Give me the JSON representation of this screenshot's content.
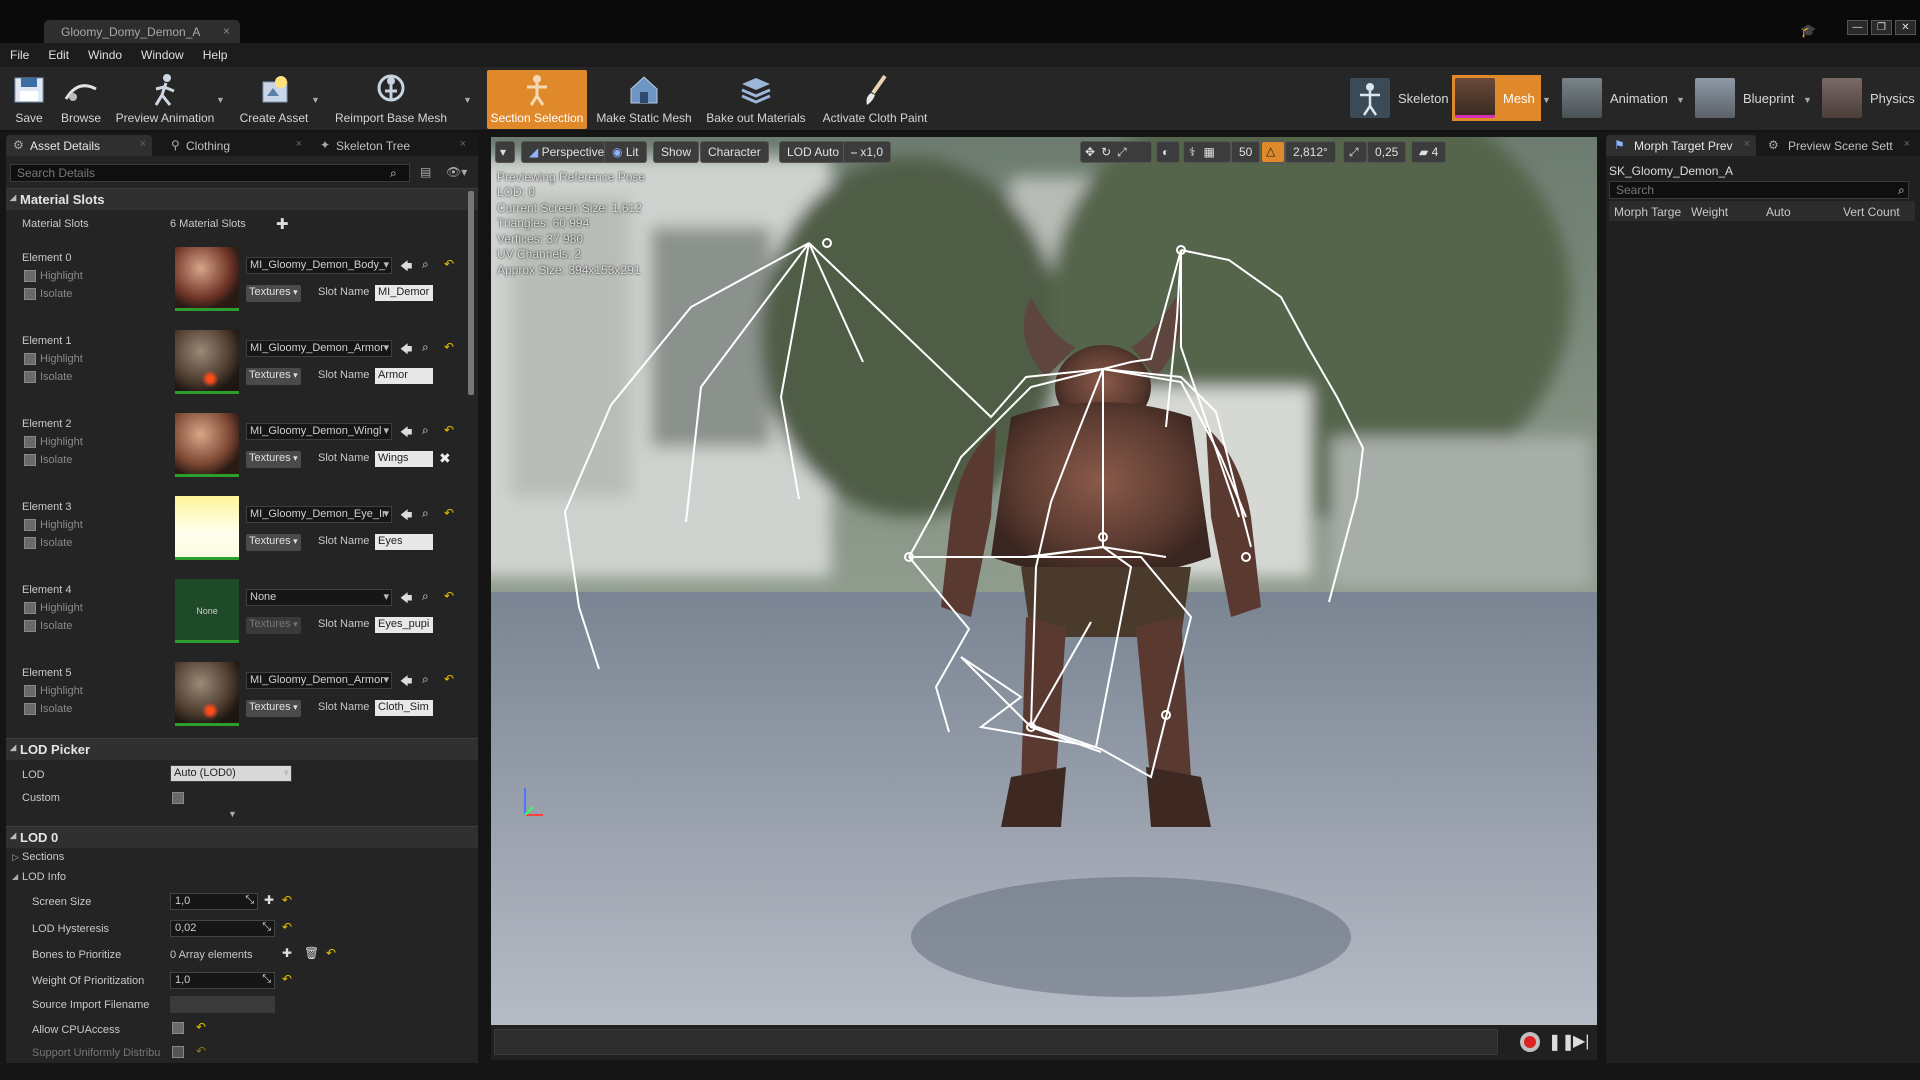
{
  "window": {
    "tab_title": "Gloomy_Domy_Demon_A"
  },
  "menu": [
    "File",
    "Edit",
    "Windo",
    "Window",
    "Help"
  ],
  "toolbar": {
    "save": "Save",
    "browse": "Browse",
    "preview_animation": "Preview Animation",
    "create_asset": "Create Asset",
    "reimport": "Reimport Base Mesh",
    "section_selection": "Section Selection",
    "make_static_mesh": "Make Static Mesh",
    "bake_materials": "Bake out Materials",
    "cloth_paint": "Activate Cloth Paint"
  },
  "modes": {
    "skeleton": "Skeleton",
    "mesh": "Mesh",
    "animation": "Animation",
    "blueprint": "Blueprint",
    "physics": "Physics"
  },
  "left_tabs": {
    "asset_details": "Asset Details",
    "clothing": "Clothing",
    "skeleton_tree": "Skeleton Tree"
  },
  "search_placeholder": "Search Details",
  "material_slots": {
    "header": "Material Slots",
    "label": "Material Slots",
    "count": "6 Material Slots",
    "highlight": "Highlight",
    "isolate": "Isolate",
    "slot_name_label": "Slot Name",
    "textures": "Textures",
    "none_thumb": "None",
    "elements": [
      {
        "name": "Element 0",
        "material": "MI_Gloomy_Demon_Body_",
        "slot": "MI_Demor"
      },
      {
        "name": "Element 1",
        "material": "MI_Gloomy_Demon_Armor",
        "slot": "Armor"
      },
      {
        "name": "Element 2",
        "material": "MI_Gloomy_Demon_Wingl",
        "slot": "Wings"
      },
      {
        "name": "Element 3",
        "material": "MI_Gloomy_Demon_Eye_Ir",
        "slot": "Eyes"
      },
      {
        "name": "Element 4",
        "material": "None",
        "slot": "Eyes_pupi"
      },
      {
        "name": "Element 5",
        "material": "MI_Gloomy_Demon_Armor",
        "slot": "Cloth_Sim"
      }
    ]
  },
  "lod_picker": {
    "header": "LOD Picker",
    "lod_label": "LOD",
    "lod_value": "Auto (LOD0)",
    "custom_label": "Custom"
  },
  "lod0": {
    "header": "LOD 0",
    "sections": "Sections",
    "lod_info": "LOD Info",
    "screen_size_label": "Screen Size",
    "screen_size": "1,0",
    "hysteresis_label": "LOD Hysteresis",
    "hysteresis": "0,02",
    "bones_label": "Bones to Prioritize",
    "bones": "0 Array elements",
    "weight_label": "Weight Of Prioritization",
    "weight": "1,0",
    "source_label": "Source Import Filename",
    "cpu_label": "Allow CPUAccess",
    "uniform_label": "Support Uniformly Distribu"
  },
  "viewport": {
    "perspective": "Perspective",
    "lit": "Lit",
    "show": "Show",
    "character": "Character",
    "lod_auto": "LOD Auto",
    "speed": "x1,0",
    "grid": "50",
    "angle": "2,812°",
    "scale": "0,25",
    "cam_speed": "4",
    "stats": [
      "Previewing Reference Pose",
      "LOD: 0",
      "Current Screen Size: 1,612",
      "Triangles: 60 994",
      "Vertices: 37 980",
      "UV Channels: 2",
      "Approx Size: 394x153x291"
    ]
  },
  "right": {
    "tab_morph": "Morph Target Prev",
    "tab_scene": "Preview Scene Sett",
    "asset": "SK_Gloomy_Demon_A",
    "search": "Search",
    "col_morph": "Morph Targe",
    "col_weight": "Weight",
    "col_auto": "Auto",
    "col_vert": "Vert Count"
  },
  "colors": {
    "accent": "#e0892a",
    "active_green": "#2d9e2d"
  }
}
